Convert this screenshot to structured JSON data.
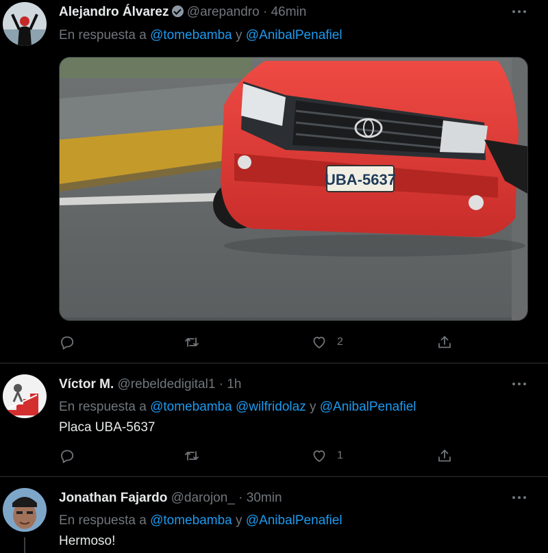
{
  "tweets": [
    {
      "name": "Alejandro Álvarez",
      "handle": "@arepandro",
      "dot": "·",
      "time": "46min",
      "reply_prefix": "En respuesta a",
      "mention1": "@tomebamba",
      "joiner": "y",
      "mention2": "@AnibalPenafiel",
      "media_plate": "UBA-5637",
      "actions": {
        "reply": "",
        "retweet": "",
        "like": "2",
        "share": ""
      }
    },
    {
      "name": "Víctor M.",
      "handle": "@rebeldedigital1",
      "dot": "·",
      "time": "1h",
      "reply_prefix": "En respuesta a",
      "mention1": "@tomebamba",
      "mention2": "@wilfridolaz",
      "joiner": "y",
      "mention3": "@AnibalPenafiel",
      "text": "Placa UBA-5637",
      "actions": {
        "reply": "",
        "retweet": "",
        "like": "1",
        "share": ""
      }
    },
    {
      "name": "Jonathan Fajardo",
      "handle": "@darojon_",
      "dot": "·",
      "time": "30min",
      "reply_prefix": "En respuesta a",
      "mention1": "@tomebamba",
      "joiner": "y",
      "mention2": "@AnibalPenafiel",
      "text": "Hermoso!"
    }
  ],
  "icons": {
    "reply": "reply-icon",
    "retweet": "retweet-icon",
    "like": "heart-icon",
    "share": "share-icon",
    "more": "more-icon",
    "verified": "verified-badge-icon"
  },
  "colors": {
    "background": "#000000",
    "link": "#1d9bf0",
    "muted": "#71767b",
    "text": "#e7e9ea",
    "divider": "#2f3336"
  }
}
